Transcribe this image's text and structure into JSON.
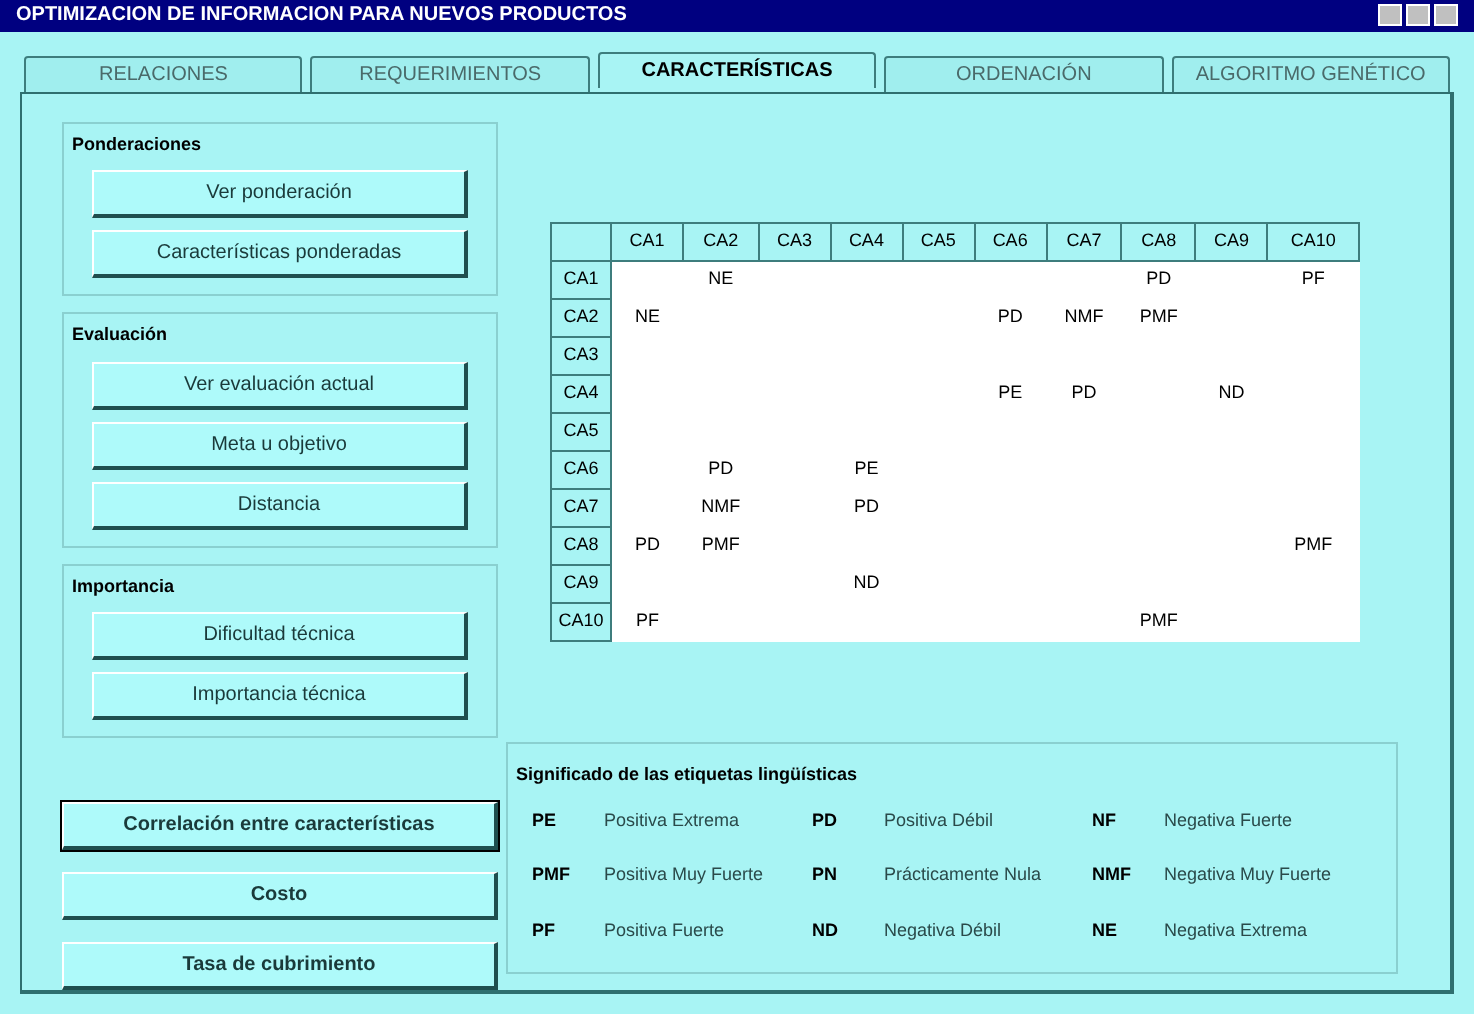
{
  "window": {
    "title": "OPTIMIZACION DE INFORMACION PARA NUEVOS PRODUCTOS"
  },
  "tabs": [
    {
      "label": "RELACIONES",
      "selected": false
    },
    {
      "label": "REQUERIMIENTOS",
      "selected": false
    },
    {
      "label": "CARACTERÍSTICAS",
      "selected": true
    },
    {
      "label": "ORDENACIÓN",
      "selected": false
    },
    {
      "label": "ALGORITMO GENÉTICO",
      "selected": false
    }
  ],
  "groups": [
    {
      "title": "Ponderaciones",
      "buttons": [
        "Ver ponderación",
        "Características ponderadas"
      ]
    },
    {
      "title": "Evaluación",
      "buttons": [
        "Ver evaluación actual",
        "Meta u objetivo",
        "Distancia"
      ]
    },
    {
      "title": "Importancia",
      "buttons": [
        "Dificultad técnica",
        "Importancia técnica"
      ]
    }
  ],
  "matrix": {
    "columns": [
      "CA1",
      "CA2",
      "CA3",
      "CA4",
      "CA5",
      "CA6",
      "CA7",
      "CA8",
      "CA9",
      "CA10"
    ],
    "rows": [
      {
        "label": "CA1",
        "cells": [
          "",
          "NE",
          "",
          "",
          "",
          "",
          "",
          "PD",
          "",
          "PF"
        ]
      },
      {
        "label": "CA2",
        "cells": [
          "NE",
          "",
          "",
          "",
          "",
          "PD",
          "NMF",
          "PMF",
          "",
          ""
        ]
      },
      {
        "label": "CA3",
        "cells": [
          "",
          "",
          "",
          "",
          "",
          "",
          "",
          "",
          "",
          ""
        ]
      },
      {
        "label": "CA4",
        "cells": [
          "",
          "",
          "",
          "",
          "",
          "PE",
          "PD",
          "",
          "ND",
          ""
        ]
      },
      {
        "label": "CA5",
        "cells": [
          "",
          "",
          "",
          "",
          "",
          "",
          "",
          "",
          "",
          ""
        ]
      },
      {
        "label": "CA6",
        "cells": [
          "",
          "PD",
          "",
          "PE",
          "",
          "",
          "",
          "",
          "",
          ""
        ]
      },
      {
        "label": "CA7",
        "cells": [
          "",
          "NMF",
          "",
          "PD",
          "",
          "",
          "",
          "",
          "",
          ""
        ]
      },
      {
        "label": "CA8",
        "cells": [
          "PD",
          "PMF",
          "",
          "",
          "",
          "",
          "",
          "",
          "",
          "PMF"
        ]
      },
      {
        "label": "CA9",
        "cells": [
          "",
          "",
          "",
          "ND",
          "",
          "",
          "",
          "",
          "",
          ""
        ]
      },
      {
        "label": "CA10",
        "cells": [
          "PF",
          "",
          "",
          "",
          "",
          "",
          "",
          "PMF",
          "",
          ""
        ]
      }
    ]
  },
  "actions": [
    {
      "label": "Correlación entre características",
      "default": true
    },
    {
      "label": "Costo",
      "default": false
    },
    {
      "label": "Tasa de cubrimiento",
      "default": false
    }
  ],
  "legend": {
    "title": "Significado de las etiquetas lingüísticas",
    "items": [
      {
        "code": "PE",
        "meaning": "Positiva Extrema"
      },
      {
        "code": "PD",
        "meaning": "Positiva Débil"
      },
      {
        "code": "NF",
        "meaning": "Negativa Fuerte"
      },
      {
        "code": "PMF",
        "meaning": "Positiva Muy Fuerte"
      },
      {
        "code": "PN",
        "meaning": "Prácticamente Nula"
      },
      {
        "code": "NMF",
        "meaning": "Negativa Muy Fuerte"
      },
      {
        "code": "PF",
        "meaning": "Positiva Fuerte"
      },
      {
        "code": "ND",
        "meaning": "Negativa Débil"
      },
      {
        "code": "NE",
        "meaning": "Negativa Extrema"
      }
    ]
  }
}
